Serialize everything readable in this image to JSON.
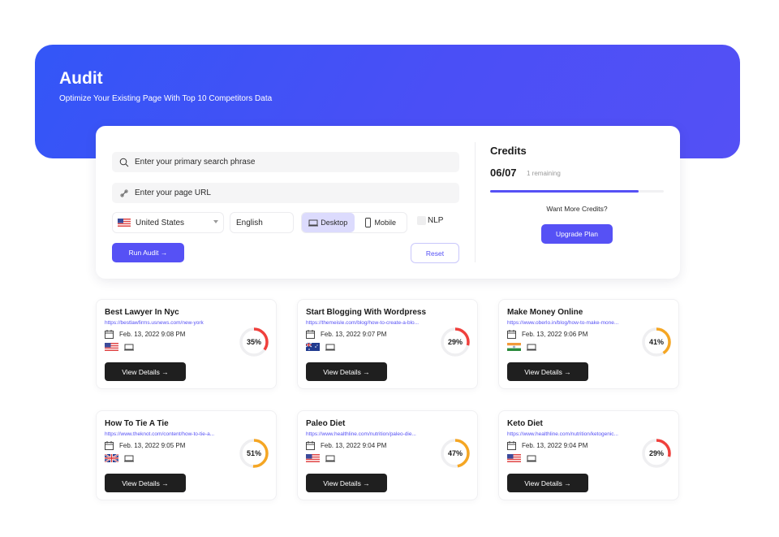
{
  "header": {
    "title": "Audit",
    "subtitle": "Optimize Your Existing Page With Top 10 Competitors Data"
  },
  "form": {
    "search_placeholder": "Enter your primary search phrase",
    "url_placeholder": "Enter your page URL",
    "country": "United States",
    "language": "English",
    "device_options": [
      {
        "label": "Desktop",
        "icon": "desktop-icon",
        "active": true
      },
      {
        "label": "Mobile",
        "icon": "mobile-icon",
        "active": false
      }
    ],
    "nlp_label": "NLP",
    "nlp_checked": false,
    "run_label": "Run Audit →",
    "reset_label": "Reset"
  },
  "credits": {
    "title": "Credits",
    "count": "06/07",
    "remaining": "1 remaining",
    "used_fraction": 0.857,
    "want_more": "Want More Credits?",
    "upgrade_label": "Upgrade Plan"
  },
  "colors": {
    "accent": "#5651f5",
    "gauge_low": "#f0403c",
    "gauge_mid": "#f5a623"
  },
  "audits": [
    {
      "title": "Best Lawyer In Nyc",
      "url": "https://bestlawfirms.usnews.com/new-york",
      "date": "Feb. 13, 2022 9:08 PM",
      "flag": "us",
      "score": 35,
      "score_label": "35%",
      "button": "View Details →"
    },
    {
      "title": "Start Blogging With Wordpress",
      "url": "https://themeisle.com/blog/how-to-create-a-blo...",
      "date": "Feb. 13, 2022 9:07 PM",
      "flag": "au",
      "score": 29,
      "score_label": "29%",
      "button": "View Details →"
    },
    {
      "title": "Make Money Online",
      "url": "https://www.oberlo.in/blog/how-to-make-mone...",
      "date": "Feb. 13, 2022 9:06 PM",
      "flag": "in",
      "score": 41,
      "score_label": "41%",
      "button": "View Details →"
    },
    {
      "title": "How To Tie A Tie",
      "url": "https://www.theknot.com/content/how-to-tie-a...",
      "date": "Feb. 13, 2022 9:05 PM",
      "flag": "gb",
      "score": 51,
      "score_label": "51%",
      "button": "View Details →"
    },
    {
      "title": "Paleo Diet",
      "url": "https://www.healthline.com/nutrition/paleo-die...",
      "date": "Feb. 13, 2022 9:04 PM",
      "flag": "us",
      "score": 47,
      "score_label": "47%",
      "button": "View Details →"
    },
    {
      "title": "Keto Diet",
      "url": "https://www.healthline.com/nutrition/ketogenic...",
      "date": "Feb. 13, 2022 9:04 PM",
      "flag": "us",
      "score": 29,
      "score_label": "29%",
      "button": "View Details →"
    }
  ]
}
